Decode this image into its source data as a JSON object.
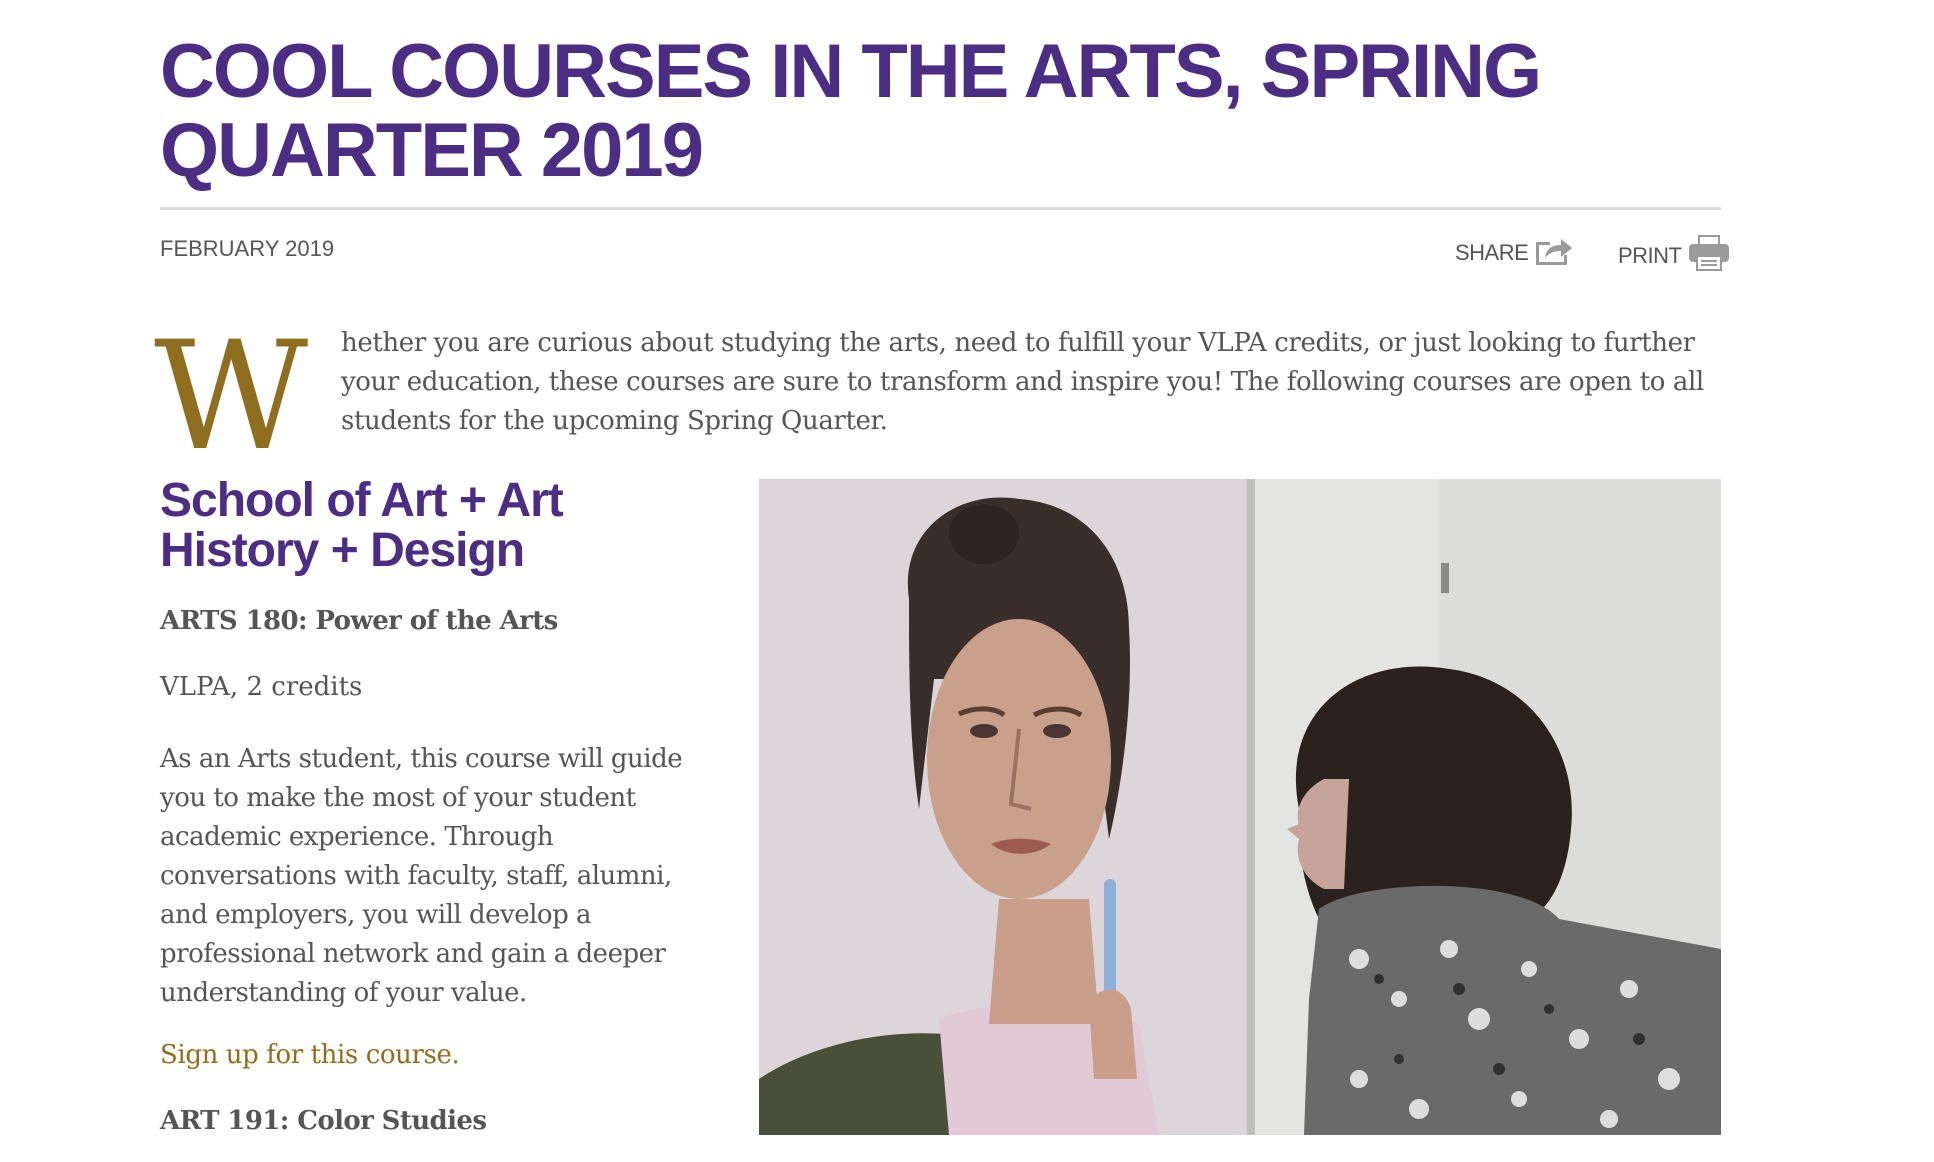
{
  "article": {
    "title": "COOL COURSES IN THE ARTS, SPRING QUARTER 2019",
    "date": "FEBRUARY 2019",
    "share_label": "SHARE",
    "print_label": "PRINT",
    "dropcap": "W",
    "intro": "hether you are curious about studying the arts, need to fulfill your VLPA credits, or just looking to further your education, these courses are sure to transform and inspire you! The following courses are open to all students for the upcoming Spring Quarter."
  },
  "section": {
    "heading": "School of Art + Art History + Design",
    "courses": [
      {
        "title": "ARTS 180: Power of the Arts",
        "meta": "VLPA, 2 credits",
        "description": "As an Arts student, this course will guide you to make the most of your student academic experience. Through conversations with faculty, staff, alumni, and employers, you will develop a professional network and gain a deeper understanding of your value.",
        "link_label": "Sign up for this course."
      },
      {
        "title": "ART 191: Color Studies"
      }
    ]
  },
  "icons": {
    "share": "share-icon",
    "print": "printer-icon"
  },
  "colors": {
    "heading_purple": "#4b2e83",
    "accent_gold": "#8f6e1f",
    "body_text": "#555555",
    "rule_gray": "#dcdcdc"
  }
}
